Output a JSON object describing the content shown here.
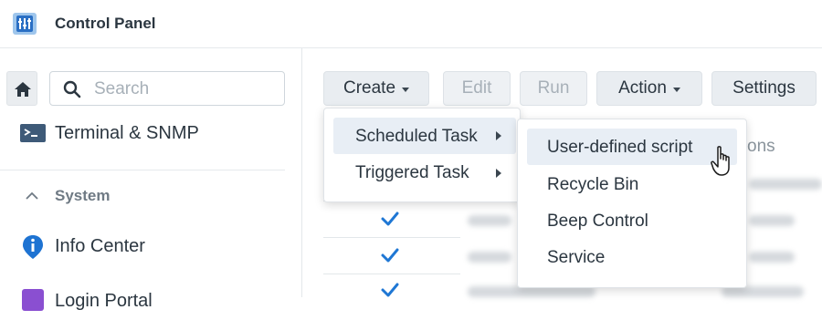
{
  "titlebar": {
    "title": "Control Panel",
    "app_icon": "control-panel-icon"
  },
  "sidebar": {
    "home_icon": "home-icon",
    "search": {
      "placeholder": "Search",
      "value": ""
    },
    "items": [
      {
        "label": "Terminal & SNMP",
        "icon": "terminal-icon"
      },
      {
        "label": "Info Center",
        "icon": "info-icon"
      },
      {
        "label": "Login Portal",
        "icon": "login-portal-icon"
      }
    ],
    "section": {
      "label": "System",
      "icon": "chevron-up-icon"
    }
  },
  "toolbar": {
    "create_label": "Create",
    "edit_label": "Edit",
    "run_label": "Run",
    "action_label": "Action",
    "settings_label": "Settings"
  },
  "create_menu": {
    "items": [
      {
        "label": "Scheduled Task",
        "selected": true
      },
      {
        "label": "Triggered Task",
        "selected": false
      }
    ]
  },
  "scheduled_submenu": {
    "items": [
      {
        "label": "User-defined script",
        "hovered": true
      },
      {
        "label": "Recycle Bin",
        "hovered": false
      },
      {
        "label": "Beep Control",
        "hovered": false
      },
      {
        "label": "Service",
        "hovered": false
      }
    ]
  },
  "table": {
    "partial_header": "ons",
    "checked_rows": [
      true,
      true,
      true
    ]
  },
  "colors": {
    "accent": "#1e73d2",
    "check": "#1f77d4"
  }
}
